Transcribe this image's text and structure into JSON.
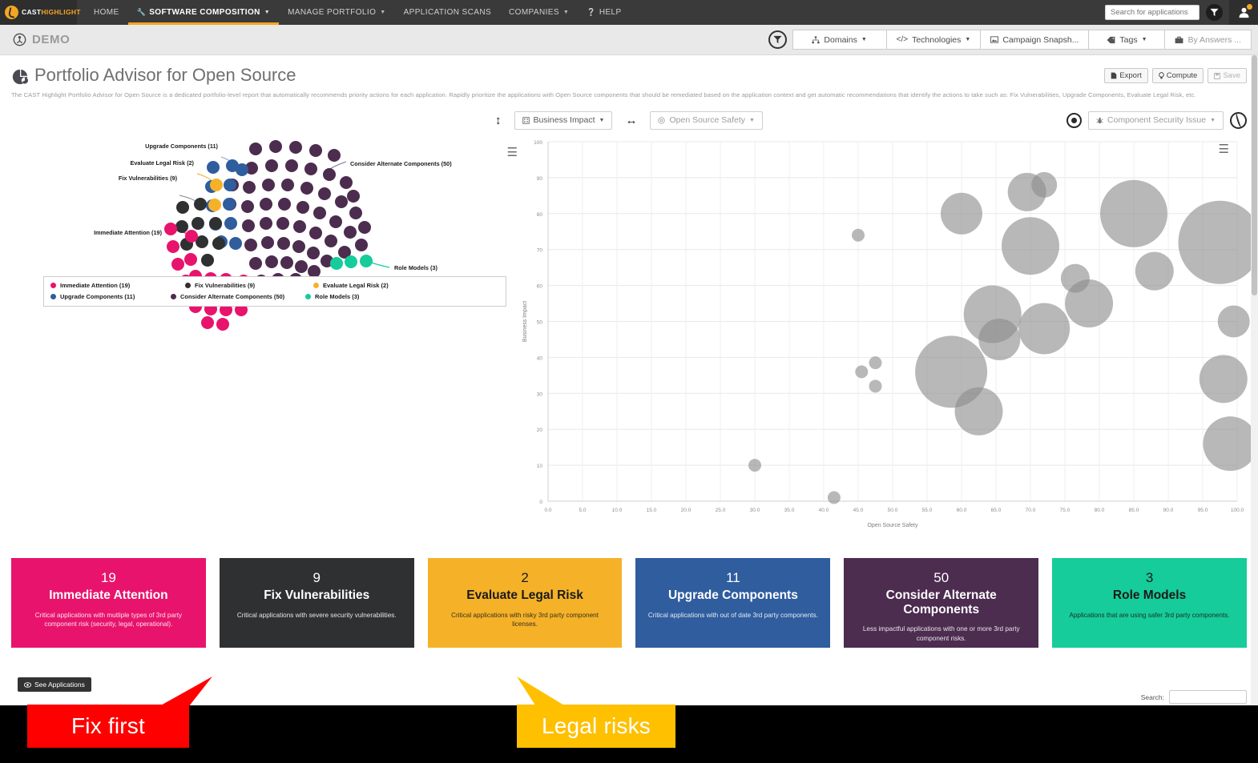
{
  "navbar": {
    "brand_cast": "CAST",
    "brand_highlight": "HIGHLIGHT",
    "items": [
      {
        "label": "HOME",
        "active": false,
        "caret": false,
        "icon": ""
      },
      {
        "label": "SOFTWARE COMPOSITION",
        "active": true,
        "caret": true,
        "icon": "wrench-icon"
      },
      {
        "label": "MANAGE PORTFOLIO",
        "active": false,
        "caret": true,
        "icon": ""
      },
      {
        "label": "APPLICATION SCANS",
        "active": false,
        "caret": false,
        "icon": ""
      },
      {
        "label": "COMPANIES",
        "active": false,
        "caret": true,
        "icon": ""
      },
      {
        "label": "HELP",
        "active": false,
        "caret": false,
        "icon": "question-icon"
      }
    ],
    "search_placeholder": "Search for applications",
    "filter_icon": "funnel-icon",
    "avatar_icon": "user-icon"
  },
  "subbar": {
    "workspace_icon": "globe-icon",
    "workspace": "DEMO",
    "funnel_icon": "funnel-icon",
    "filters": [
      {
        "label": "Domains",
        "icon": "sitemap-icon",
        "caret": true
      },
      {
        "label": "Technologies",
        "icon": "code-icon",
        "caret": true
      },
      {
        "label": "Campaign Snapsh...",
        "icon": "image-icon",
        "caret": false
      },
      {
        "label": "Tags",
        "icon": "tag-icon",
        "caret": true
      },
      {
        "label": "By Answers ...",
        "icon": "briefcase-icon",
        "caret": false
      }
    ]
  },
  "page": {
    "title_icon": "pie-chart-icon",
    "title": "Portfolio Advisor for Open Source",
    "description": "The CAST Highlight Portfolio Advisor for Open Source is a dedicated portfolio-level report that automatically recommends priority actions for each application. Rapidly prioritize the applications with Open Source components that should be remediated based on the application context and get automatic recommendations that identify the actions to take such as: Fix Vulnerabilities, Upgrade Components, Evaluate Legal Risk, etc.",
    "actions": [
      {
        "label": "Export",
        "icon": "file-export-icon",
        "disabled": false
      },
      {
        "label": "Compute",
        "icon": "bulb-icon",
        "disabled": false
      },
      {
        "label": "Save",
        "icon": "save-icon",
        "disabled": true
      }
    ]
  },
  "chart_controls": {
    "y_axis_icon": "updown-arrow-icon",
    "y_axis_label": "Business Impact",
    "y_axis_prefix_icon": "building-icon",
    "x_axis_icon": "leftright-arrow-icon",
    "x_axis_label": "Open Source Safety",
    "x_axis_prefix_icon": "shield-icon",
    "bubble_icon": "target-icon",
    "bubble_label": "Component Security Issue",
    "bubble_prefix_icon": "bug-icon",
    "globe_icon": "globe-outline-icon",
    "menu_icon": "hamburger-icon"
  },
  "chart_data": [
    {
      "type": "pie",
      "name": "advisor-dot-arc",
      "title": "",
      "legend_position": "bottom",
      "categories": [
        "Immediate Attention",
        "Fix Vulnerabilities",
        "Evaluate Legal Risk",
        "Upgrade Components",
        "Consider Alternate Components",
        "Role Models"
      ],
      "values": [
        19,
        9,
        2,
        11,
        50,
        3
      ],
      "colors": [
        "#e8136c",
        "#2f3031",
        "#f5b229",
        "#2f5d9e",
        "#4c2c4f",
        "#16cc9a"
      ],
      "labels": [
        "Immediate Attention (19)",
        "Fix Vulnerabilities (9)",
        "Evaluate Legal Risk (2)",
        "Upgrade Components (11)",
        "Consider Alternate Components (50)",
        "Role Models (3)"
      ],
      "legend": [
        "Immediate Attention (19)",
        "Fix Vulnerabilities (9)",
        "Evaluate Legal Risk (2)",
        "Upgrade Components (11)",
        "Consider Alternate Components (50)",
        "Role Models (3)"
      ]
    },
    {
      "type": "scatter",
      "name": "business-impact-vs-safety",
      "title": "",
      "xlabel": "Open Source Safety",
      "ylabel": "Business Impact",
      "xlim": [
        0,
        100
      ],
      "ylim": [
        0,
        100
      ],
      "xticks": [
        "0.0",
        "5.0",
        "10.0",
        "15.0",
        "20.0",
        "25.0",
        "30.0",
        "35.0",
        "40.0",
        "45.0",
        "50.0",
        "55.0",
        "60.0",
        "65.0",
        "70.0",
        "75.0",
        "80.0",
        "85.0",
        "90.0",
        "95.0",
        "100.0"
      ],
      "yticks": [
        "0",
        "10",
        "20",
        "30",
        "40",
        "50",
        "60",
        "70",
        "80",
        "90",
        "100"
      ],
      "grid": true,
      "bubble_color": "#8c8c8c",
      "points": [
        {
          "x": 30.0,
          "y": 10.0,
          "r": 8
        },
        {
          "x": 41.5,
          "y": 1.0,
          "r": 8
        },
        {
          "x": 45.0,
          "y": 74.0,
          "r": 8
        },
        {
          "x": 45.5,
          "y": 36.0,
          "r": 8
        },
        {
          "x": 47.5,
          "y": 38.5,
          "r": 8
        },
        {
          "x": 47.5,
          "y": 32.0,
          "r": 8
        },
        {
          "x": 58.5,
          "y": 36.0,
          "r": 45
        },
        {
          "x": 62.5,
          "y": 25.0,
          "r": 30
        },
        {
          "x": 60.0,
          "y": 80.0,
          "r": 26
        },
        {
          "x": 64.5,
          "y": 52.0,
          "r": 36
        },
        {
          "x": 65.5,
          "y": 45.0,
          "r": 26
        },
        {
          "x": 70.0,
          "y": 71.0,
          "r": 36
        },
        {
          "x": 69.5,
          "y": 86.0,
          "r": 24
        },
        {
          "x": 72.0,
          "y": 88.0,
          "r": 16
        },
        {
          "x": 72.0,
          "y": 48.0,
          "r": 32
        },
        {
          "x": 76.5,
          "y": 62.0,
          "r": 18
        },
        {
          "x": 78.5,
          "y": 55.0,
          "r": 30
        },
        {
          "x": 85.0,
          "y": 80.0,
          "r": 42
        },
        {
          "x": 88.0,
          "y": 64.0,
          "r": 24
        },
        {
          "x": 97.5,
          "y": 72.0,
          "r": 52
        },
        {
          "x": 98.0,
          "y": 34.0,
          "r": 30
        },
        {
          "x": 99.0,
          "y": 16.0,
          "r": 34
        },
        {
          "x": 99.5,
          "y": 50.0,
          "r": 20
        }
      ]
    }
  ],
  "cards": [
    {
      "count": "19",
      "name": "Immediate Attention",
      "desc": "Critical applications with mutliple types of 3rd party component risk (security, legal, operational).",
      "bg": "#e8136c",
      "fg": "#ffffff"
    },
    {
      "count": "9",
      "name": "Fix Vulnerabilities",
      "desc": "Critical applications with severe security vulnerabilities.",
      "bg": "#2f3031",
      "fg": "#ffffff"
    },
    {
      "count": "2",
      "name": "Evaluate Legal Risk",
      "desc": "Critical applications with risky 3rd party component licenses.",
      "bg": "#f5b229",
      "fg": "#1a1a1a"
    },
    {
      "count": "11",
      "name": "Upgrade Components",
      "desc": "Critical applications with out of date 3rd party components.",
      "bg": "#2f5d9e",
      "fg": "#ffffff"
    },
    {
      "count": "50",
      "name": "Consider Alternate Components",
      "desc": "Less impactful applications with one or more 3rd party component risks.",
      "bg": "#4c2c4f",
      "fg": "#ffffff"
    },
    {
      "count": "3",
      "name": "Role Models",
      "desc": "Applications that are using safer 3rd party components.",
      "bg": "#16cc9a",
      "fg": "#1a1a1a"
    }
  ],
  "footer": {
    "see_applications_icon": "eye-icon",
    "see_applications": "See Applications",
    "search_label": "Search:",
    "search_value": ""
  },
  "annotations": [
    {
      "text": "Fix first",
      "bg": "#fe0000",
      "fg": "#ffffff"
    },
    {
      "text": "Legal risks",
      "bg": "#ffc000",
      "fg": "#ffffff"
    }
  ]
}
